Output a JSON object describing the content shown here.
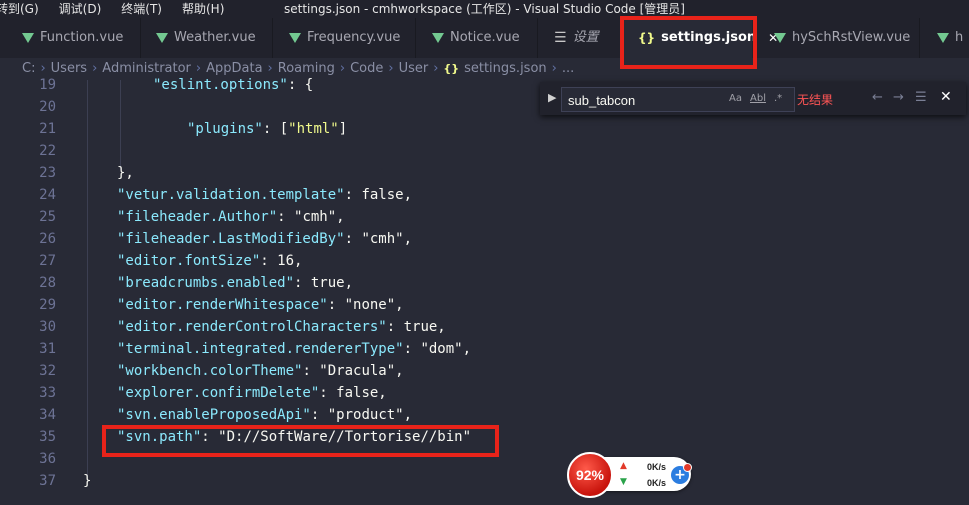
{
  "menu": [
    "转到(G)",
    "调试(D)",
    "终端(T)",
    "帮助(H)"
  ],
  "window_title": "settings.json - cmhworkspace (工作区) - Visual Studio Code [管理员]",
  "tabs": [
    {
      "label": "Function.vue",
      "icon": "vue-icon"
    },
    {
      "label": "Weather.vue",
      "icon": "vue-icon"
    },
    {
      "label": "Frequency.vue",
      "icon": "vue-icon"
    },
    {
      "label": "Notice.vue",
      "icon": "vue-icon"
    },
    {
      "label": "设置",
      "icon": "settings-icon"
    },
    {
      "label": "settings.json",
      "icon": "json-icon",
      "active": true
    },
    {
      "label": "hySchRstView.vue",
      "icon": "vue-icon"
    },
    {
      "label": "h",
      "icon": "vue-icon"
    }
  ],
  "breadcrumb": [
    "C:",
    "Users",
    "Administrator",
    "AppData",
    "Roaming",
    "Code",
    "User",
    "settings.json",
    "..."
  ],
  "find": {
    "value": "sub_tabcon",
    "match_case": "Aa",
    "whole_word": "Abl",
    "regex": ".*",
    "no_results": "无结果"
  },
  "code_lines": [
    {
      "n": "19",
      "text": "    \"eslint.options\": {"
    },
    {
      "n": "20",
      "text": ""
    },
    {
      "n": "21",
      "text": "        \"plugins\": [\"html\"]"
    },
    {
      "n": "22",
      "text": ""
    },
    {
      "n": "23",
      "text": "},"
    },
    {
      "n": "24",
      "text": "\"vetur.validation.template\": false,"
    },
    {
      "n": "25",
      "text": "\"fileheader.Author\": \"cmh\","
    },
    {
      "n": "26",
      "text": "\"fileheader.LastModifiedBy\": \"cmh\","
    },
    {
      "n": "27",
      "text": "\"editor.fontSize\": 16,"
    },
    {
      "n": "28",
      "text": "\"breadcrumbs.enabled\": true,"
    },
    {
      "n": "29",
      "text": "\"editor.renderWhitespace\": \"none\","
    },
    {
      "n": "30",
      "text": "\"editor.renderControlCharacters\": true,"
    },
    {
      "n": "31",
      "text": "\"terminal.integrated.rendererType\": \"dom\","
    },
    {
      "n": "32",
      "text": "\"workbench.colorTheme\": \"Dracula\","
    },
    {
      "n": "33",
      "text": "\"explorer.confirmDelete\": false,"
    },
    {
      "n": "34",
      "text": "\"svn.enableProposedApi\": \"product\","
    },
    {
      "n": "35",
      "text": "\"svn.path\": \"D://SoftWare//Tortorise//bin\""
    },
    {
      "n": "36",
      "text": ""
    },
    {
      "n": "37",
      "text": "}"
    }
  ],
  "speed": {
    "percent": "92%",
    "up": "0K/s",
    "down": "0K/s"
  }
}
